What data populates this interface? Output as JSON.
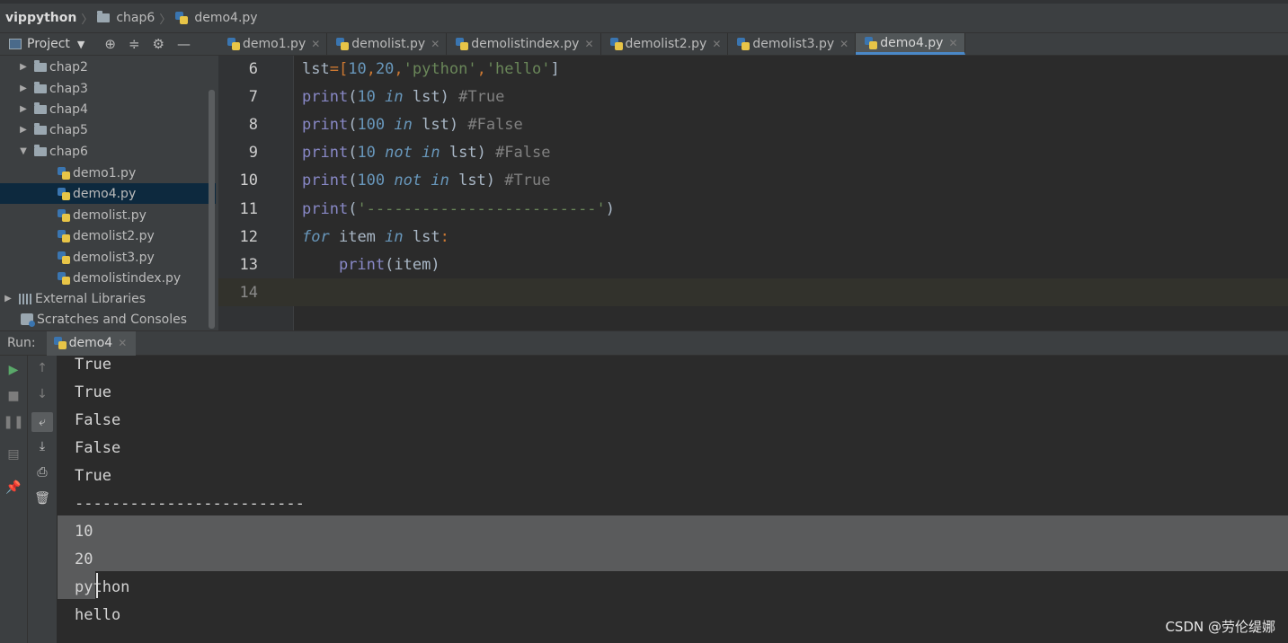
{
  "breadcrumb": {
    "project": "vippython",
    "folder": "chap6",
    "file": "demo4.py"
  },
  "project_toolbar": {
    "label": "Project"
  },
  "tabs": [
    {
      "label": "demo1.py",
      "active": false
    },
    {
      "label": "demolist.py",
      "active": false
    },
    {
      "label": "demolistindex.py",
      "active": false
    },
    {
      "label": "demolist2.py",
      "active": false
    },
    {
      "label": "demolist3.py",
      "active": false
    },
    {
      "label": "demo4.py",
      "active": true
    }
  ],
  "tree": {
    "folders": [
      "chap2",
      "chap3",
      "chap4",
      "chap5",
      "chap6"
    ],
    "files": [
      "demo1.py",
      "demo4.py",
      "demolist.py",
      "demolist2.py",
      "demolist3.py",
      "demolistindex.py"
    ],
    "selected": "demo4.py",
    "external_libraries": "External Libraries",
    "scratches": "Scratches and Consoles"
  },
  "editor": {
    "line_numbers": [
      "6",
      "7",
      "8",
      "9",
      "10",
      "11",
      "12",
      "13",
      "14"
    ],
    "code": {
      "l6": {
        "a": "lst",
        "b": "=[",
        "c": "10",
        "d": ",",
        "e": "20",
        "f": ",",
        "g": "'python'",
        "h": ",",
        "i": "'hello'",
        "j": "]"
      },
      "l7": {
        "fn": "print",
        "o": "(",
        "num": "10",
        "kw": "in",
        "var": "lst",
        "cp": ")",
        "cm": "#True"
      },
      "l8": {
        "fn": "print",
        "o": "(",
        "num": "100",
        "kw": "in",
        "var": "lst",
        "cp": ")",
        "cm": "#False"
      },
      "l9": {
        "fn": "print",
        "o": "(",
        "num": "10",
        "kw": "not in",
        "var": "lst",
        "cp": ")",
        "cm": "#False"
      },
      "l10": {
        "fn": "print",
        "o": "(",
        "num": "100",
        "kw": "not in",
        "var": "lst",
        "cp": ")",
        "cm": "#True"
      },
      "l11": {
        "fn": "print",
        "o": "(",
        "str": "'-------------------------'",
        "cp": ")"
      },
      "l12": {
        "kw1": "for",
        "var": "item",
        "kw2": "in",
        "var2": "lst",
        "colon": ":"
      },
      "l13": {
        "fn": "print",
        "args": "(item)"
      }
    }
  },
  "run": {
    "label": "Run:",
    "tab": "demo4",
    "output": [
      "True",
      "True",
      "False",
      "False",
      "True",
      "-------------------------",
      "10",
      "20",
      "python",
      "hello"
    ]
  },
  "watermark": "CSDN @劳伦缇娜"
}
